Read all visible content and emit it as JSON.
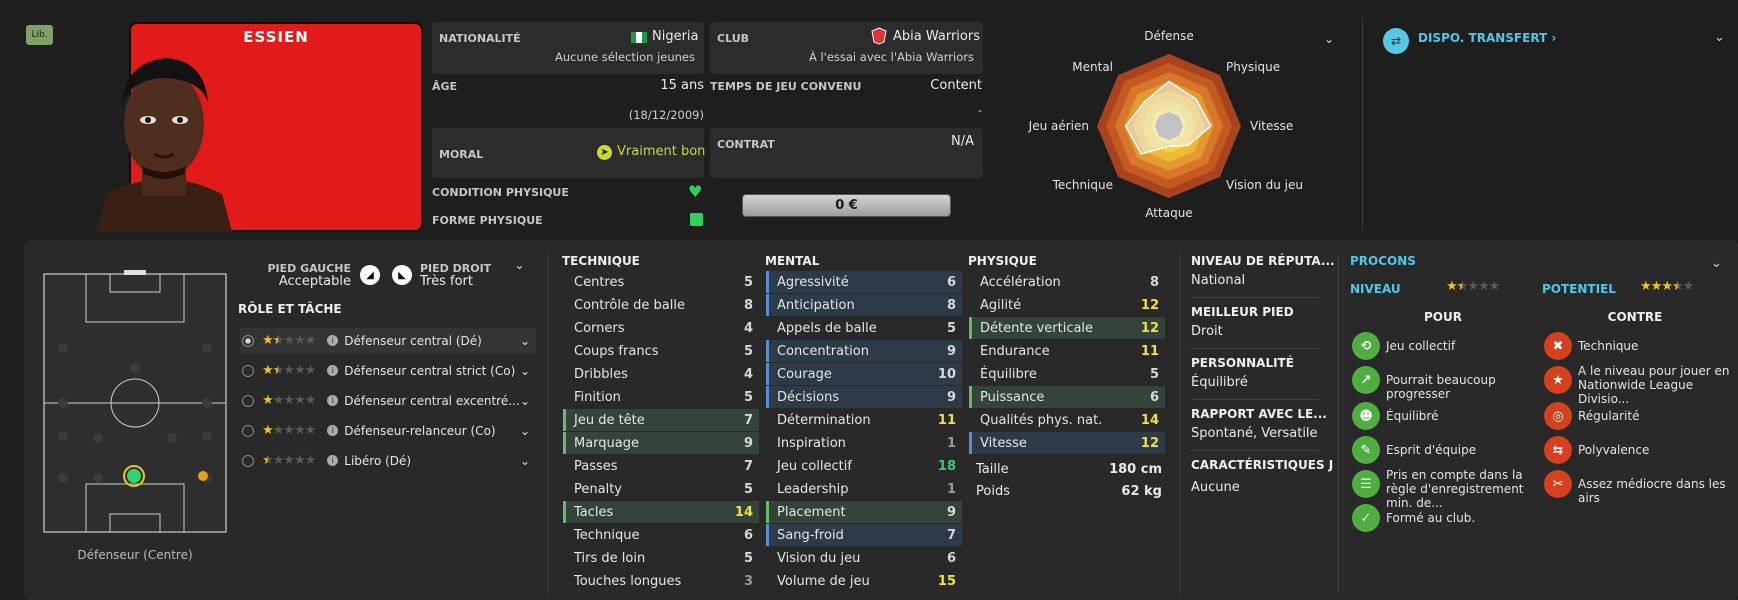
{
  "player": {
    "badge": "Lib.",
    "name": "ESSIEN"
  },
  "info": {
    "nationality_label": "NATIONALITÉ",
    "nationality": "Nigeria",
    "nationality_sub": "Aucune sélection jeunes",
    "club_label": "CLUB",
    "club": "Abia Warriors",
    "club_sub": "À l'essai avec l'Abia Warriors",
    "age_label": "ÂGE",
    "age": "15 ans",
    "dob": "(18/12/2009)",
    "playtime_label": "TEMPS DE JEU CONVENU",
    "playtime": "Content",
    "playtime_sub": "-",
    "morale_label": "MORAL",
    "morale": "Vraiment bon",
    "contract_label": "CONTRAT",
    "contract": "N/A",
    "condition_label": "CONDITION PHYSIQUE",
    "form_label": "FORME PHYSIQUE",
    "value": "0 €"
  },
  "radar": {
    "labels": [
      "Défense",
      "Physique",
      "Vitesse",
      "Vision du jeu",
      "Attaque",
      "Technique",
      "Jeu aérien",
      "Mental"
    ],
    "values": [
      0.62,
      0.53,
      0.58,
      0.38,
      0.28,
      0.55,
      0.6,
      0.48
    ]
  },
  "transfer": {
    "label": "DISPO. TRANSFERT"
  },
  "feet": {
    "left_label": "PIED GAUCHE",
    "left": "Acceptable",
    "right_label": "PIED DROIT",
    "right": "Très fort"
  },
  "roles": {
    "title": "RÔLE ET TÂCHE",
    "items": [
      {
        "name": "Défenseur central (Dé)",
        "stars": 1.5
      },
      {
        "name": "Défenseur central strict (Co)",
        "stars": 1.5
      },
      {
        "name": "Défenseur central excentré...",
        "stars": 1
      },
      {
        "name": "Défenseur-relanceur (Co)",
        "stars": 1
      },
      {
        "name": "Libéro (Dé)",
        "stars": 0.5
      }
    ]
  },
  "pitch": {
    "position_label": "Défenseur (Centre)"
  },
  "technique": {
    "title": "TECHNIQUE",
    "items": [
      {
        "name": "Centres",
        "value": 5,
        "hl": ""
      },
      {
        "name": "Contrôle de balle",
        "value": 8,
        "hl": ""
      },
      {
        "name": "Corners",
        "value": 4,
        "hl": ""
      },
      {
        "name": "Coups francs",
        "value": 5,
        "hl": ""
      },
      {
        "name": "Dribbles",
        "value": 4,
        "hl": ""
      },
      {
        "name": "Finition",
        "value": 5,
        "hl": ""
      },
      {
        "name": "Jeu de tête",
        "value": 7,
        "hl": "gr"
      },
      {
        "name": "Marquage",
        "value": 9,
        "hl": "gr"
      },
      {
        "name": "Passes",
        "value": 7,
        "hl": ""
      },
      {
        "name": "Penalty",
        "value": 5,
        "hl": ""
      },
      {
        "name": "Tacles",
        "value": 14,
        "hl": "gr"
      },
      {
        "name": "Technique",
        "value": 6,
        "hl": ""
      },
      {
        "name": "Tirs de loin",
        "value": 5,
        "hl": ""
      },
      {
        "name": "Touches longues",
        "value": 3,
        "hl": ""
      }
    ]
  },
  "mental": {
    "title": "MENTAL",
    "items": [
      {
        "name": "Agressivité",
        "value": 6,
        "hl": "bl"
      },
      {
        "name": "Anticipation",
        "value": 8,
        "hl": "bl"
      },
      {
        "name": "Appels de balle",
        "value": 5,
        "hl": ""
      },
      {
        "name": "Concentration",
        "value": 9,
        "hl": "bl"
      },
      {
        "name": "Courage",
        "value": 10,
        "hl": "bl"
      },
      {
        "name": "Décisions",
        "value": 9,
        "hl": "bl"
      },
      {
        "name": "Détermination",
        "value": 11,
        "hl": ""
      },
      {
        "name": "Inspiration",
        "value": 1,
        "hl": ""
      },
      {
        "name": "Jeu collectif",
        "value": 18,
        "hl": ""
      },
      {
        "name": "Leadership",
        "value": 1,
        "hl": ""
      },
      {
        "name": "Placement",
        "value": 9,
        "hl": "gr"
      },
      {
        "name": "Sang-froid",
        "value": 7,
        "hl": "bl"
      },
      {
        "name": "Vision du jeu",
        "value": 6,
        "hl": ""
      },
      {
        "name": "Volume de jeu",
        "value": 15,
        "hl": ""
      }
    ]
  },
  "physique": {
    "title": "PHYSIQUE",
    "items": [
      {
        "name": "Accélération",
        "value": 8,
        "hl": ""
      },
      {
        "name": "Agilité",
        "value": 12,
        "hl": ""
      },
      {
        "name": "Détente verticale",
        "value": 12,
        "hl": "gr"
      },
      {
        "name": "Endurance",
        "value": 11,
        "hl": ""
      },
      {
        "name": "Équilibre",
        "value": 5,
        "hl": ""
      },
      {
        "name": "Puissance",
        "value": 6,
        "hl": "gr"
      },
      {
        "name": "Qualités phys. nat.",
        "value": 14,
        "hl": ""
      },
      {
        "name": "Vitesse",
        "value": 12,
        "hl": "bl"
      }
    ],
    "height_label": "Taille",
    "height": "180 cm",
    "weight_label": "Poids",
    "weight": "62 kg"
  },
  "summary": {
    "reputation_label": "NIVEAU DE RÉPUTA...",
    "reputation": "National",
    "best_foot_label": "MEILLEUR PIED",
    "best_foot": "Droit",
    "personality_label": "PERSONNALITÉ",
    "personality": "Équilibré",
    "media_label": "RAPPORT AVEC LE...",
    "media": "Spontané, Versatile",
    "traits_label": "CARACTÉRISTIQUES J",
    "traits": "Aucune"
  },
  "procons": {
    "title": "PROCONS",
    "level_label": "NIVEAU",
    "level_stars": 1.5,
    "potential_label": "POTENTIEL",
    "potential_stars": 3.5,
    "pros_label": "POUR",
    "cons_label": "CONTRE",
    "pros": [
      "Jeu collectif",
      "Pourrait beaucoup progresser",
      "Équilibré",
      "Esprit d'équipe",
      "Pris en compte dans la règle d'enregistrement min. de...",
      "Formé au club."
    ],
    "cons": [
      "Technique",
      "A le niveau pour jouer en Nationwide League Divisio...",
      "Régularité",
      "Polyvalence",
      "Assez médiocre dans les airs"
    ]
  }
}
